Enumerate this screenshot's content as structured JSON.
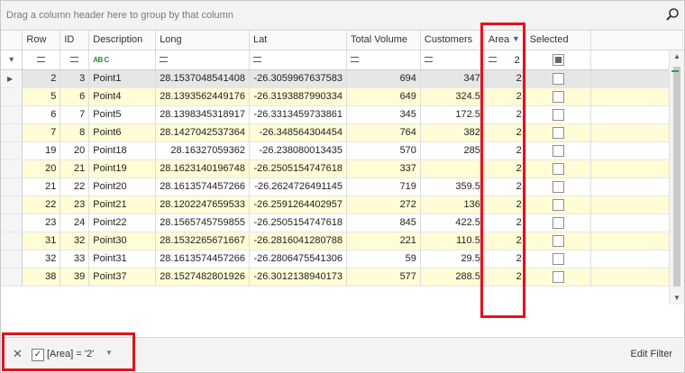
{
  "group_panel": {
    "hint": "Drag a column header here to group by that column",
    "search_icon": "search-icon"
  },
  "columns": [
    {
      "key": "row",
      "label": "Row"
    },
    {
      "key": "id",
      "label": "ID"
    },
    {
      "key": "desc",
      "label": "Description"
    },
    {
      "key": "long",
      "label": "Long"
    },
    {
      "key": "lat",
      "label": "Lat"
    },
    {
      "key": "vol",
      "label": "Total Volume"
    },
    {
      "key": "cust",
      "label": "Customers"
    },
    {
      "key": "area",
      "label": "Area"
    },
    {
      "key": "sel",
      "label": "Selected"
    }
  ],
  "filter_row": {
    "area_value": "2"
  },
  "rows": [
    {
      "row": "2",
      "id": "3",
      "desc": "Point1",
      "long": "28.1537048541408",
      "lat": "-26.3059967637583",
      "vol": "694",
      "cust": "347",
      "area": "2"
    },
    {
      "row": "5",
      "id": "6",
      "desc": "Point4",
      "long": "28.1393562449176",
      "lat": "-26.3193887990334",
      "vol": "649",
      "cust": "324.5",
      "area": "2"
    },
    {
      "row": "6",
      "id": "7",
      "desc": "Point5",
      "long": "28.1398345318917",
      "lat": "-26.3313459733861",
      "vol": "345",
      "cust": "172.5",
      "area": "2"
    },
    {
      "row": "7",
      "id": "8",
      "desc": "Point6",
      "long": "28.1427042537364",
      "lat": "-26.348564304454",
      "vol": "764",
      "cust": "382",
      "area": "2"
    },
    {
      "row": "19",
      "id": "20",
      "desc": "Point18",
      "long": "28.16327059362",
      "lat": "-26.238080013435",
      "vol": "570",
      "cust": "285",
      "area": "2"
    },
    {
      "row": "20",
      "id": "21",
      "desc": "Point19",
      "long": "28.1623140196748",
      "lat": "-26.2505154747618",
      "vol": "337",
      "cust": "",
      "area": "2"
    },
    {
      "row": "21",
      "id": "22",
      "desc": "Point20",
      "long": "28.1613574457266",
      "lat": "-26.2624726491145",
      "vol": "719",
      "cust": "359.5",
      "area": "2"
    },
    {
      "row": "22",
      "id": "23",
      "desc": "Point21",
      "long": "28.1202247659533",
      "lat": "-26.2591264402957",
      "vol": "272",
      "cust": "136",
      "area": "2"
    },
    {
      "row": "23",
      "id": "24",
      "desc": "Point22",
      "long": "28.1565745759855",
      "lat": "-26.2505154747618",
      "vol": "845",
      "cust": "422.5",
      "area": "2"
    },
    {
      "row": "31",
      "id": "32",
      "desc": "Point30",
      "long": "28.1532265671667",
      "lat": "-26.2816041280788",
      "vol": "221",
      "cust": "110.5",
      "area": "2"
    },
    {
      "row": "32",
      "id": "33",
      "desc": "Point31",
      "long": "28.1613574457266",
      "lat": "-26.2806475541306",
      "vol": "59",
      "cust": "29.5",
      "area": "2"
    },
    {
      "row": "38",
      "id": "39",
      "desc": "Point37",
      "long": "28.1527482801926",
      "lat": "-26.3012138940173",
      "vol": "577",
      "cust": "288.5",
      "area": "2"
    }
  ],
  "filter_panel": {
    "expression": "[Area] = '2'",
    "edit_label": "Edit Filter"
  },
  "colors": {
    "highlight": "#e0141e",
    "alt_row": "#fffcd6",
    "focused_row": "#e6e6e6"
  }
}
